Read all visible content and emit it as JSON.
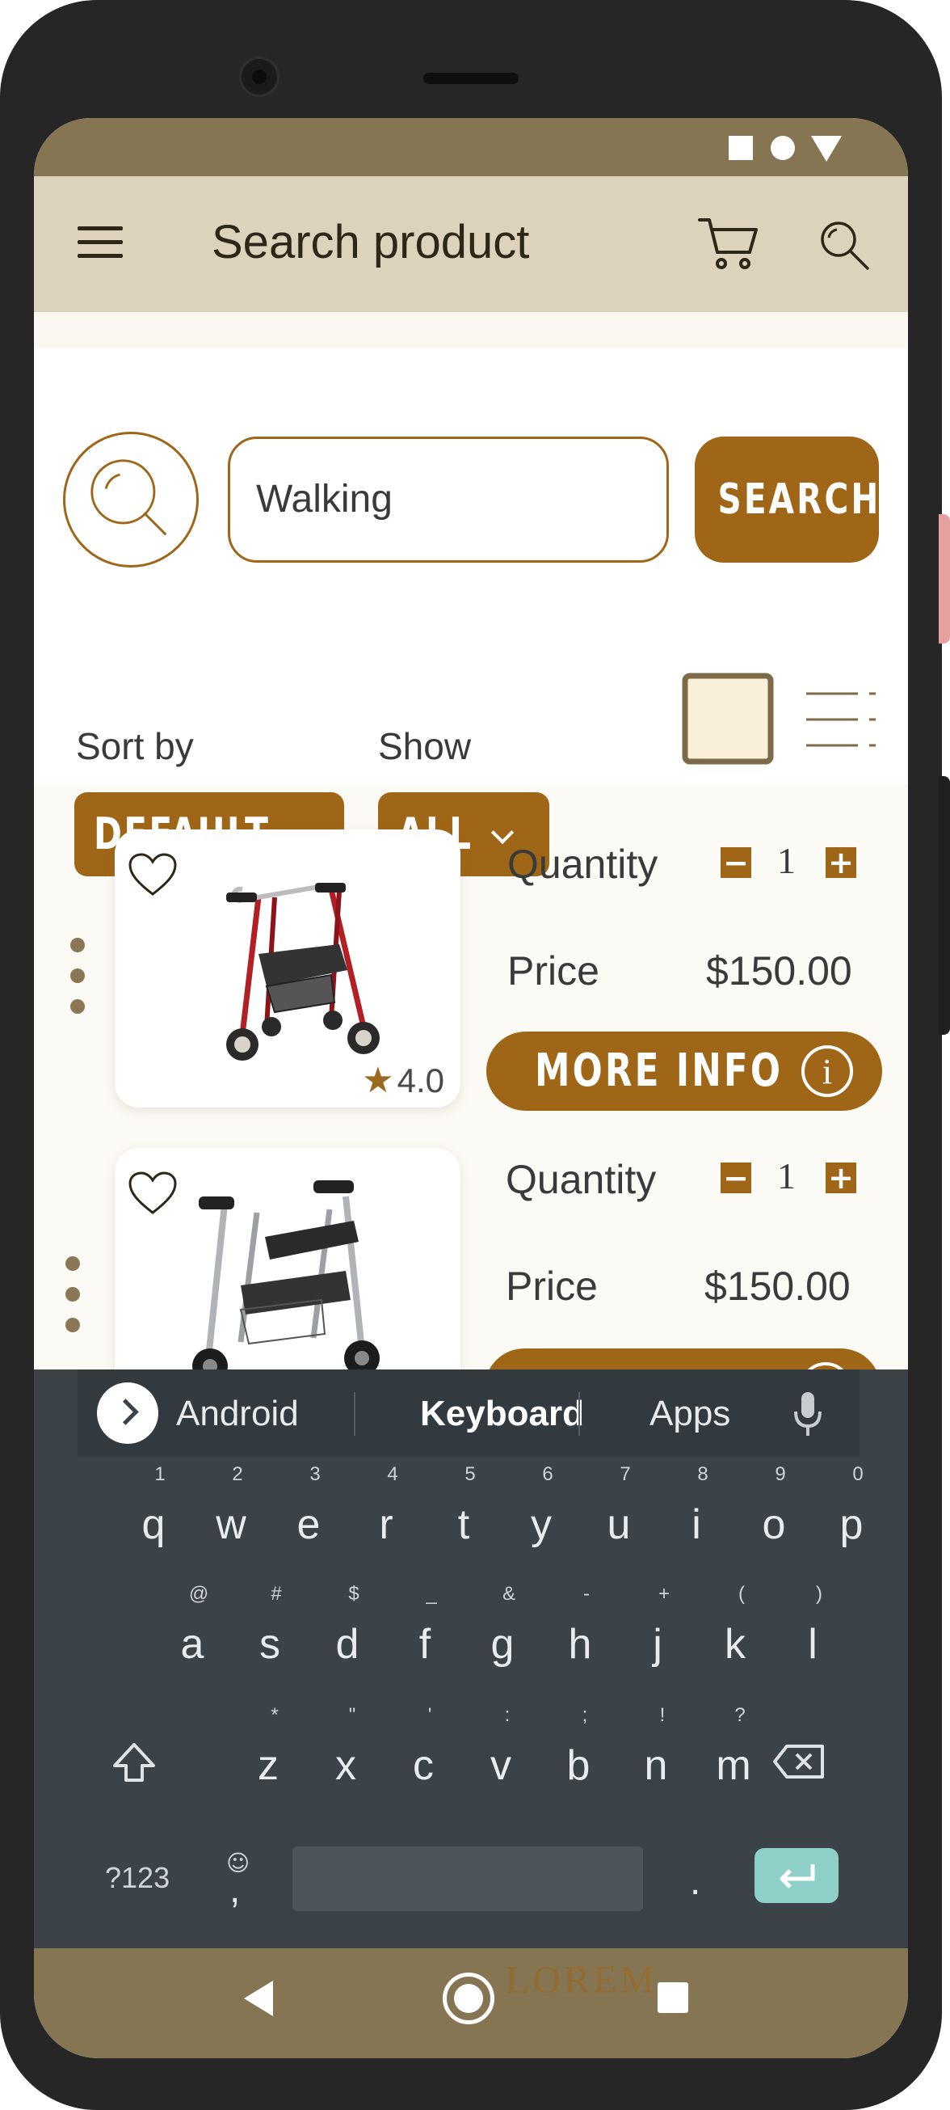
{
  "app": {
    "title": "Search product"
  },
  "search": {
    "value": "Walking",
    "button_label": "SEARCH"
  },
  "filters": {
    "sort_label": "Sort by",
    "sort_value": "DEFAULT",
    "show_label": "Show",
    "show_value": "ALL"
  },
  "products": [
    {
      "rating": "4.0",
      "quantity_label": "Quantity",
      "quantity": "1",
      "price_label": "Price",
      "price": "$150.00",
      "more_info_label": "MORE INFO"
    },
    {
      "quantity_label": "Quantity",
      "quantity": "1",
      "price_label": "Price",
      "price": "$150.00"
    }
  ],
  "keyboard": {
    "suggestions": [
      "Android",
      "Keyboard",
      "Apps"
    ],
    "row1": [
      "q",
      "w",
      "e",
      "r",
      "t",
      "y",
      "u",
      "i",
      "o",
      "p"
    ],
    "row1_sup": [
      "1",
      "2",
      "3",
      "4",
      "5",
      "6",
      "7",
      "8",
      "9",
      "0"
    ],
    "row2": [
      "a",
      "s",
      "d",
      "f",
      "g",
      "h",
      "j",
      "k",
      "l"
    ],
    "row2_sup": [
      "@",
      "#",
      "$",
      "_",
      "&",
      "-",
      "+",
      "(",
      ")"
    ],
    "row3": [
      "z",
      "x",
      "c",
      "v",
      "b",
      "n",
      "m"
    ],
    "row3_sup": [
      "*",
      "\"",
      "'",
      ":",
      ";",
      "!",
      "?"
    ],
    "symbols_key": "?123",
    "comma": ",",
    "period": "."
  },
  "navbar": {
    "watermark": "LOREM"
  },
  "colors": {
    "brand": "#a06618",
    "appbar": "#ddd3bd",
    "statusbar": "#867552",
    "keyboard": "#3b4248",
    "enter": "#8ed0c8"
  },
  "icons": [
    "menu-icon",
    "cart-icon",
    "search-icon",
    "heart-icon",
    "star-icon",
    "info-icon",
    "chevron-down-icon",
    "grid-view-icon",
    "list-view-icon",
    "mic-icon",
    "shift-icon",
    "backspace-icon",
    "enter-icon"
  ]
}
